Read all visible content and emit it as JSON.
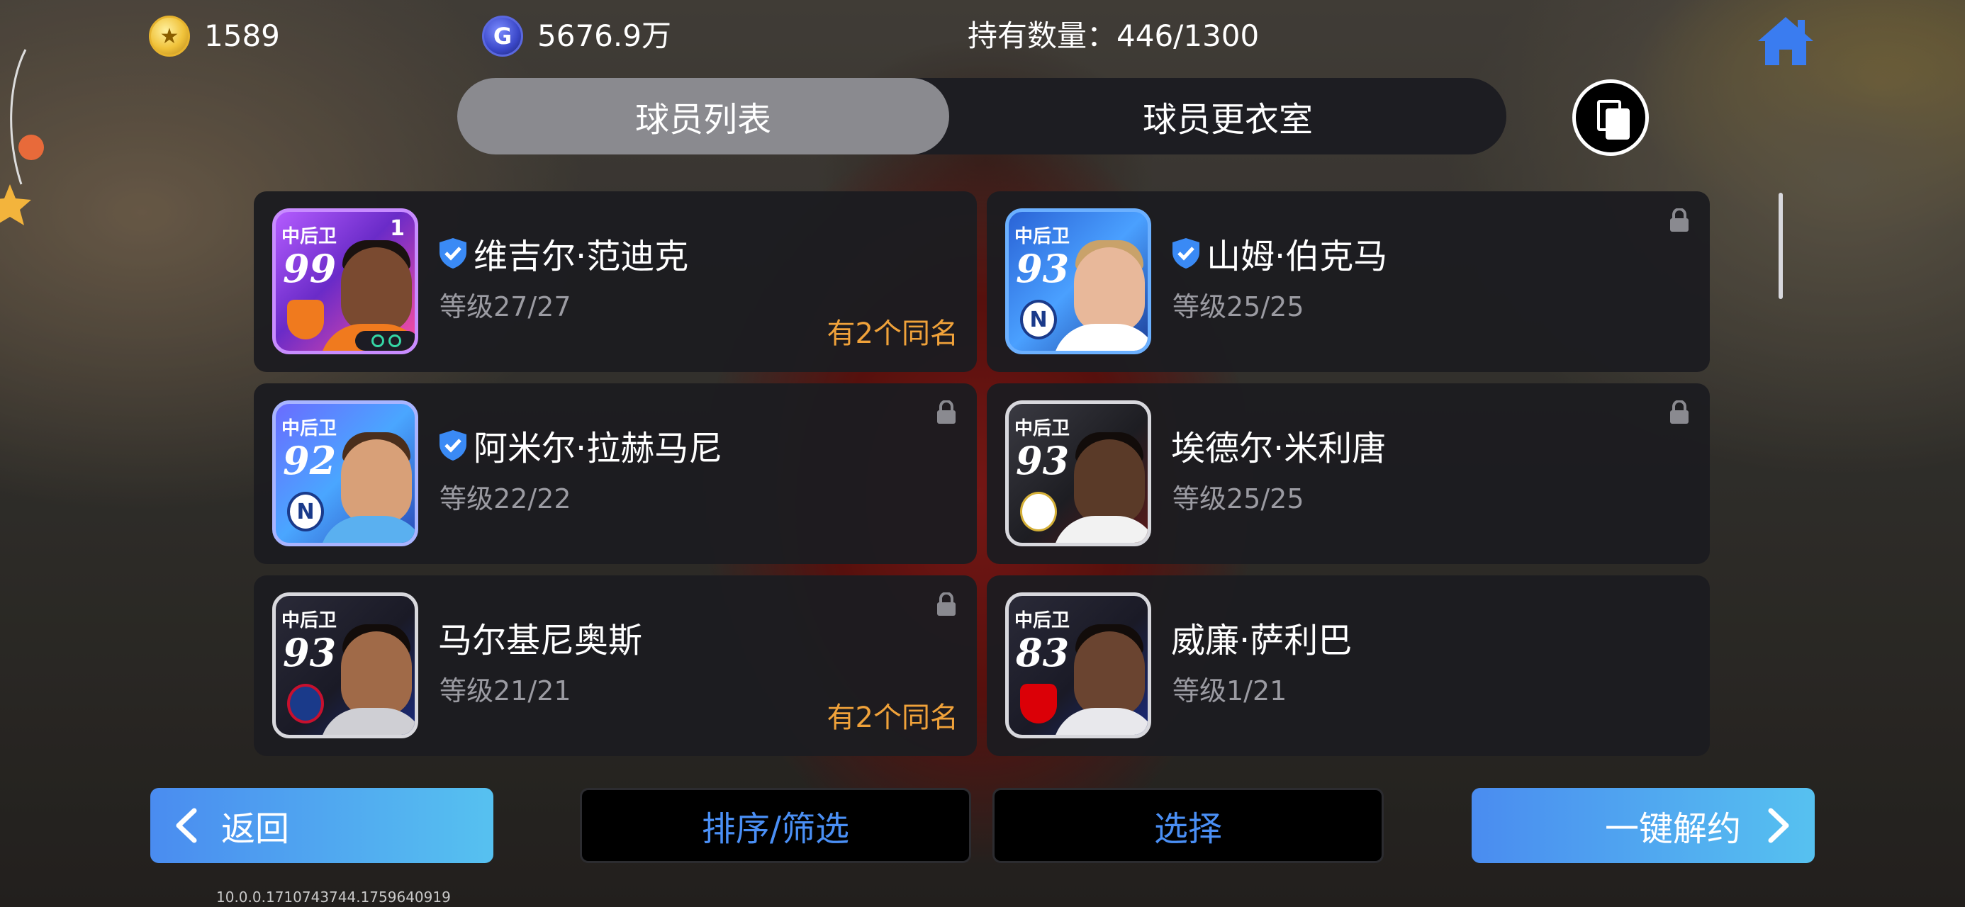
{
  "topbar": {
    "gold_coins": "1589",
    "gp": "5676.9万",
    "holdings": "持有数量：446/1300"
  },
  "tabs": [
    {
      "label": "球员列表",
      "active": true
    },
    {
      "label": "球员更衣室",
      "active": false
    }
  ],
  "players": [
    {
      "position": "中后卫",
      "rating": "99",
      "name": "维吉尔·范迪克",
      "level": "等级27/27",
      "duplicate": "有2个同名",
      "verified": true,
      "locked": false,
      "badge_number": "1"
    },
    {
      "position": "中后卫",
      "rating": "93",
      "name": "山姆·伯克马",
      "level": "等级25/25",
      "duplicate": "",
      "verified": true,
      "locked": true
    },
    {
      "position": "中后卫",
      "rating": "92",
      "name": "阿米尔·拉赫马尼",
      "level": "等级22/22",
      "duplicate": "",
      "verified": true,
      "locked": true
    },
    {
      "position": "中后卫",
      "rating": "93",
      "name": "埃德尔·米利唐",
      "level": "等级25/25",
      "duplicate": "",
      "verified": false,
      "locked": true
    },
    {
      "position": "中后卫",
      "rating": "93",
      "name": "马尔基尼奥斯",
      "level": "等级21/21",
      "duplicate": "有2个同名",
      "verified": false,
      "locked": true
    },
    {
      "position": "中后卫",
      "rating": "83",
      "name": "威廉·萨利巴",
      "level": "等级1/21",
      "duplicate": "",
      "verified": false,
      "locked": false
    }
  ],
  "buttons": {
    "back": "返回",
    "sort_filter": "排序/筛选",
    "select": "选择",
    "release_all": "一键解约"
  },
  "version": "10.0.0.1710743744.1759640919",
  "colors": {
    "accent_blue": "#4a8ff5",
    "duplicate_orange": "#f0a23a",
    "card_bg": "#1c1c20"
  }
}
